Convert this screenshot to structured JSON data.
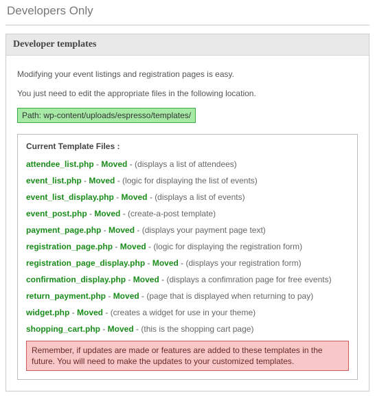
{
  "page": {
    "title": "Developers Only"
  },
  "panel": {
    "header": "Developer templates",
    "intro1": "Modifying your event listings and registration pages is easy.",
    "intro2": "You just need to edit the appropriate files in the following location.",
    "path": "Path: wp-content/uploads/espresso/templates/",
    "files_title": "Current Template Files :",
    "files": [
      {
        "name": "attendee_list.php",
        "status": "Moved",
        "desc": "(displays a list of attendees)"
      },
      {
        "name": "event_list.php",
        "status": "Moved",
        "desc": "(logic for displaying the list of events)"
      },
      {
        "name": "event_list_display.php",
        "status": "Moved",
        "desc": "(displays a list of events)"
      },
      {
        "name": "event_post.php",
        "status": "Moved",
        "desc": "(create-a-post template)"
      },
      {
        "name": "payment_page.php",
        "status": "Moved",
        "desc": "(displays your payment page text)"
      },
      {
        "name": "registration_page.php",
        "status": "Moved",
        "desc": "(logic for displaying the registration form)"
      },
      {
        "name": "registration_page_display.php",
        "status": "Moved",
        "desc": "(displays your registration form)"
      },
      {
        "name": "confirmation_display.php",
        "status": "Moved",
        "desc": "(displays a confimration page for free events)"
      },
      {
        "name": "return_payment.php",
        "status": "Moved",
        "desc": "(page that is displayed when returning to pay)"
      },
      {
        "name": "widget.php",
        "status": "Moved",
        "desc": "(creates a widget for use in your theme)"
      },
      {
        "name": "shopping_cart.php",
        "status": "Moved",
        "desc": "(this is the shopping cart page)"
      }
    ],
    "warning": "Remember, if updates are made or features are added to these templates in the future. You will need to make the updates to your customized templates."
  }
}
